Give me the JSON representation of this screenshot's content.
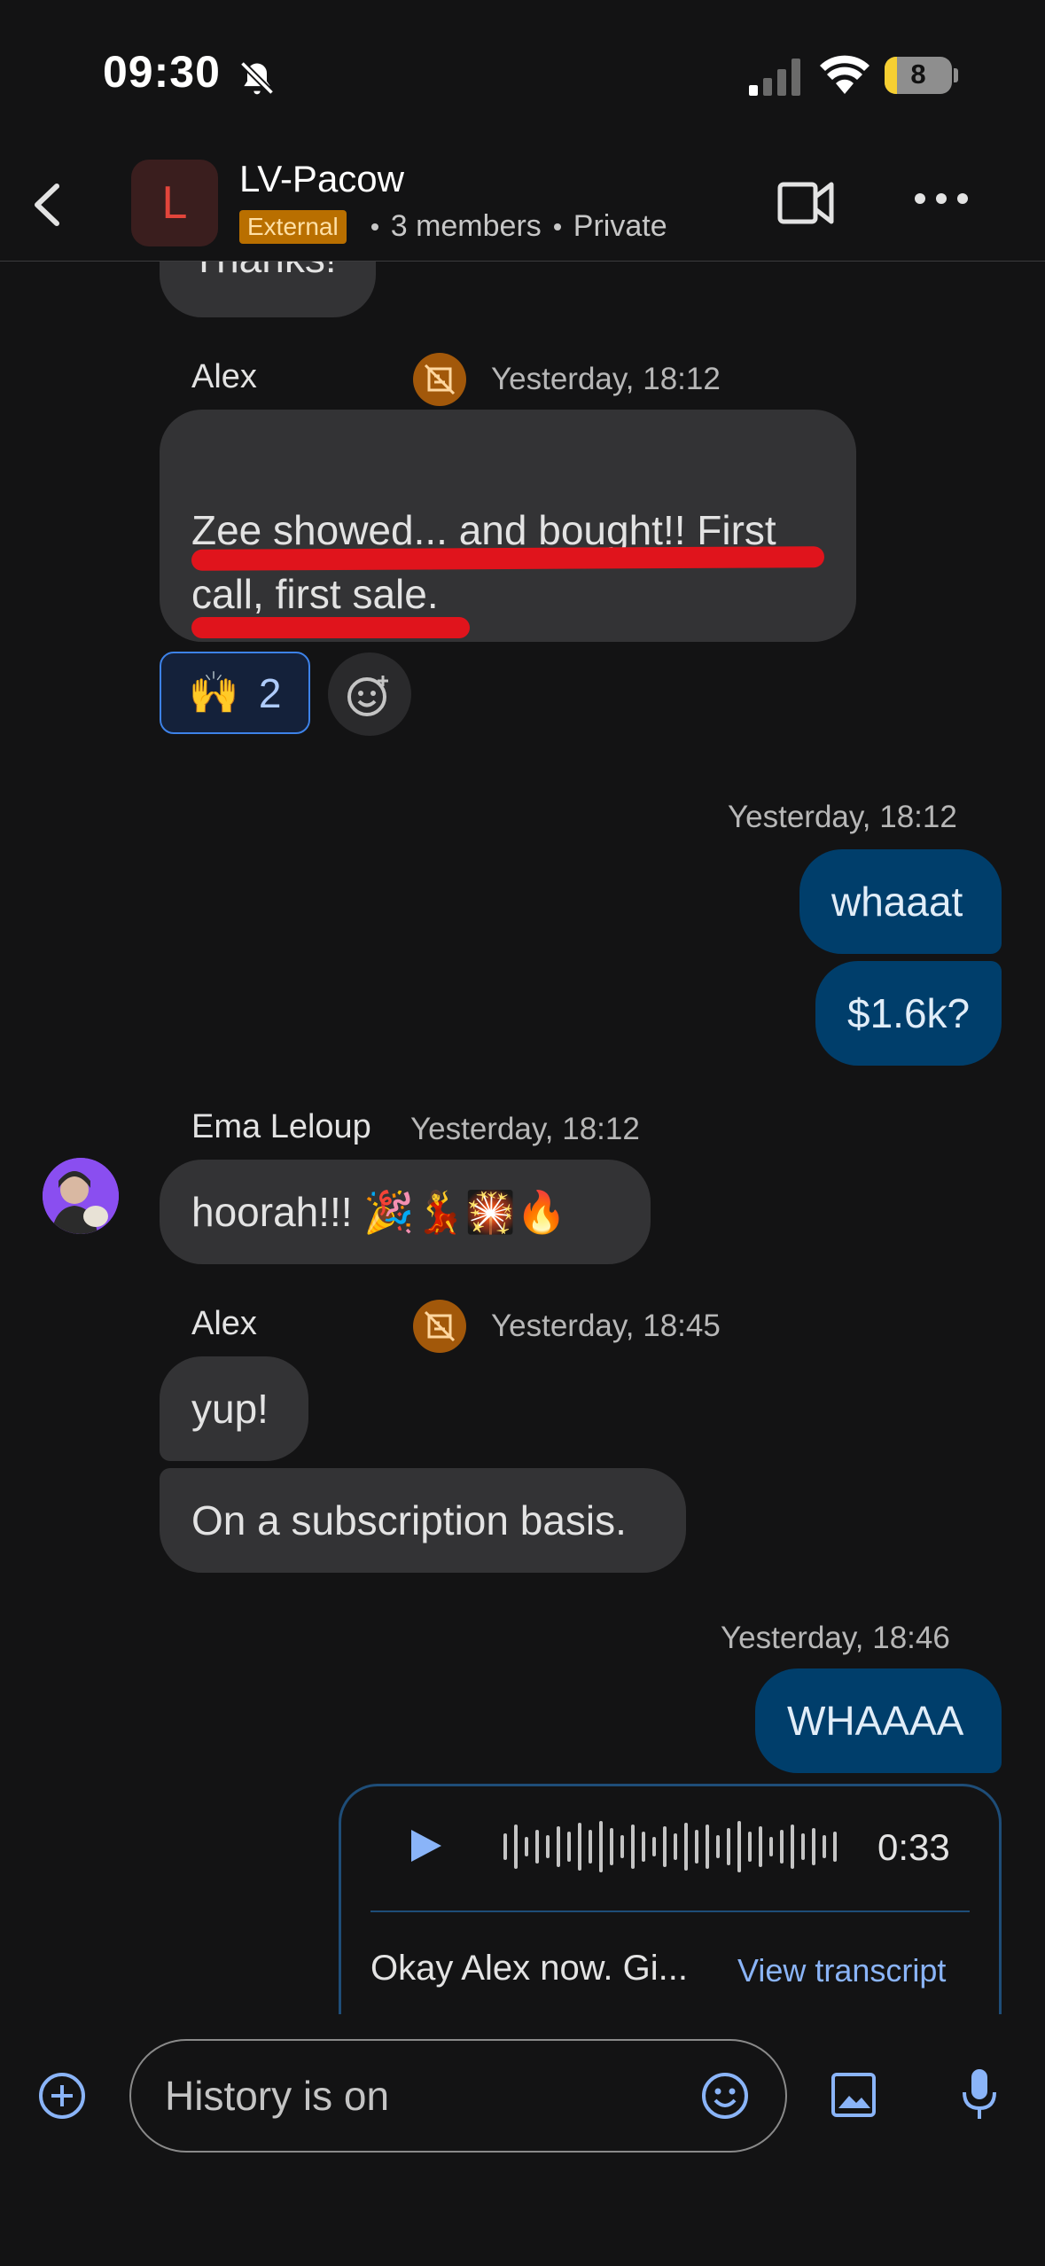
{
  "status_bar": {
    "time": "09:30",
    "battery": "8"
  },
  "header": {
    "avatar_letter": "L",
    "title": "LV-Pacow",
    "badge": "External",
    "members": "3 members",
    "privacy": "Private"
  },
  "messages": {
    "cut_top": "Thanks!",
    "m1": {
      "sender": "Alex",
      "time": "Yesterday, 18:12",
      "line1": "Zee showed... and bought!! First",
      "line2": "call, first sale.",
      "reaction_emoji": "🙌",
      "reaction_count": "2"
    },
    "m2": {
      "time": "Yesterday, 18:12",
      "b1": "whaaat",
      "b2": "$1.6k?"
    },
    "m3": {
      "sender": "Ema Leloup",
      "time": "Yesterday, 18:12",
      "text": "hoorah!!! 🎉💃🎇🔥"
    },
    "m4": {
      "sender": "Alex",
      "time": "Yesterday, 18:45",
      "b1": "yup!",
      "b2": "On a subscription basis."
    },
    "m5": {
      "time": "Yesterday, 18:46",
      "b1": "WHAAAA"
    },
    "voice": {
      "duration": "0:33",
      "preview": "Okay Alex now. Gi...",
      "link": "View transcript"
    }
  },
  "composer": {
    "placeholder": "History is on"
  },
  "colors": {
    "accent": "#8ab4f8",
    "my_bubble": "#003e6b",
    "highlight": "#e0141c",
    "external": "#b96f00"
  }
}
